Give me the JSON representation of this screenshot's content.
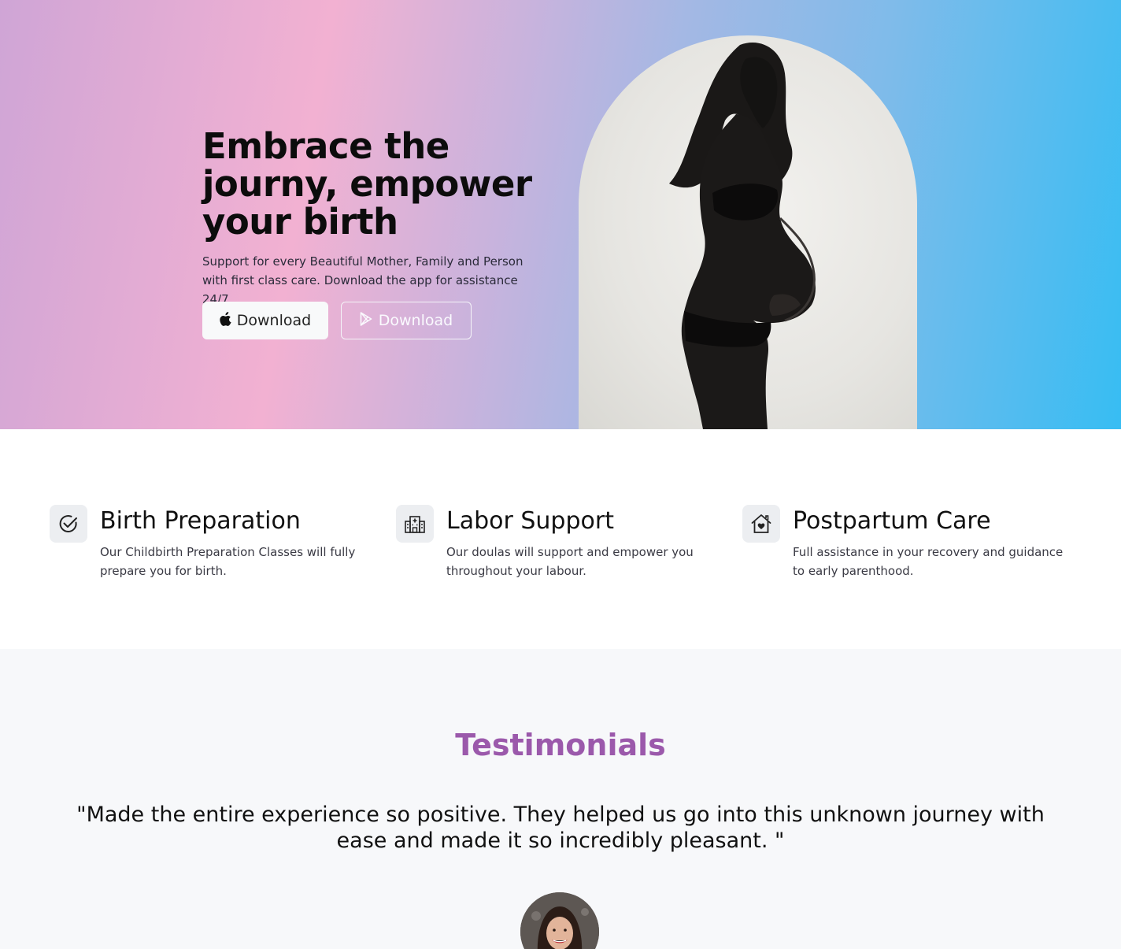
{
  "hero": {
    "title": "Embrace the journy, empower your birth",
    "subtitle": "Support for every Beautiful Mother, Family and Person with first class care. Download the app for assistance 24/7.",
    "buttons": [
      {
        "label": "Download",
        "icon": "apple-icon"
      },
      {
        "label": "Download",
        "icon": "google-play-icon"
      }
    ],
    "image": "pregnant-woman-silhouette"
  },
  "features": [
    {
      "icon": "check-circle-icon",
      "title": "Birth Preparation",
      "text": "Our Childbirth Preparation Classes will fully prepare you for birth."
    },
    {
      "icon": "hospital-icon",
      "title": "Labor Support",
      "text": "Our doulas will support and empower you throughout your labour."
    },
    {
      "icon": "house-heart-icon",
      "title": "Postpartum Care",
      "text": "Full assistance in your recovery and guidance to early parenthood."
    }
  ],
  "testimonials": {
    "title": "Testimonials",
    "quote": "\"Made the entire experience so positive. They helped us go into this unknown journey with ease and made it so incredibly pleasant. \"",
    "avatar": "testimonial-avatar"
  },
  "colors": {
    "accent": "#9b59ab",
    "gradient_start": "#cfa5d6",
    "gradient_pink": "#f2b1d2",
    "gradient_end": "#37bdf3",
    "section_bg": "#f7f8fa"
  }
}
